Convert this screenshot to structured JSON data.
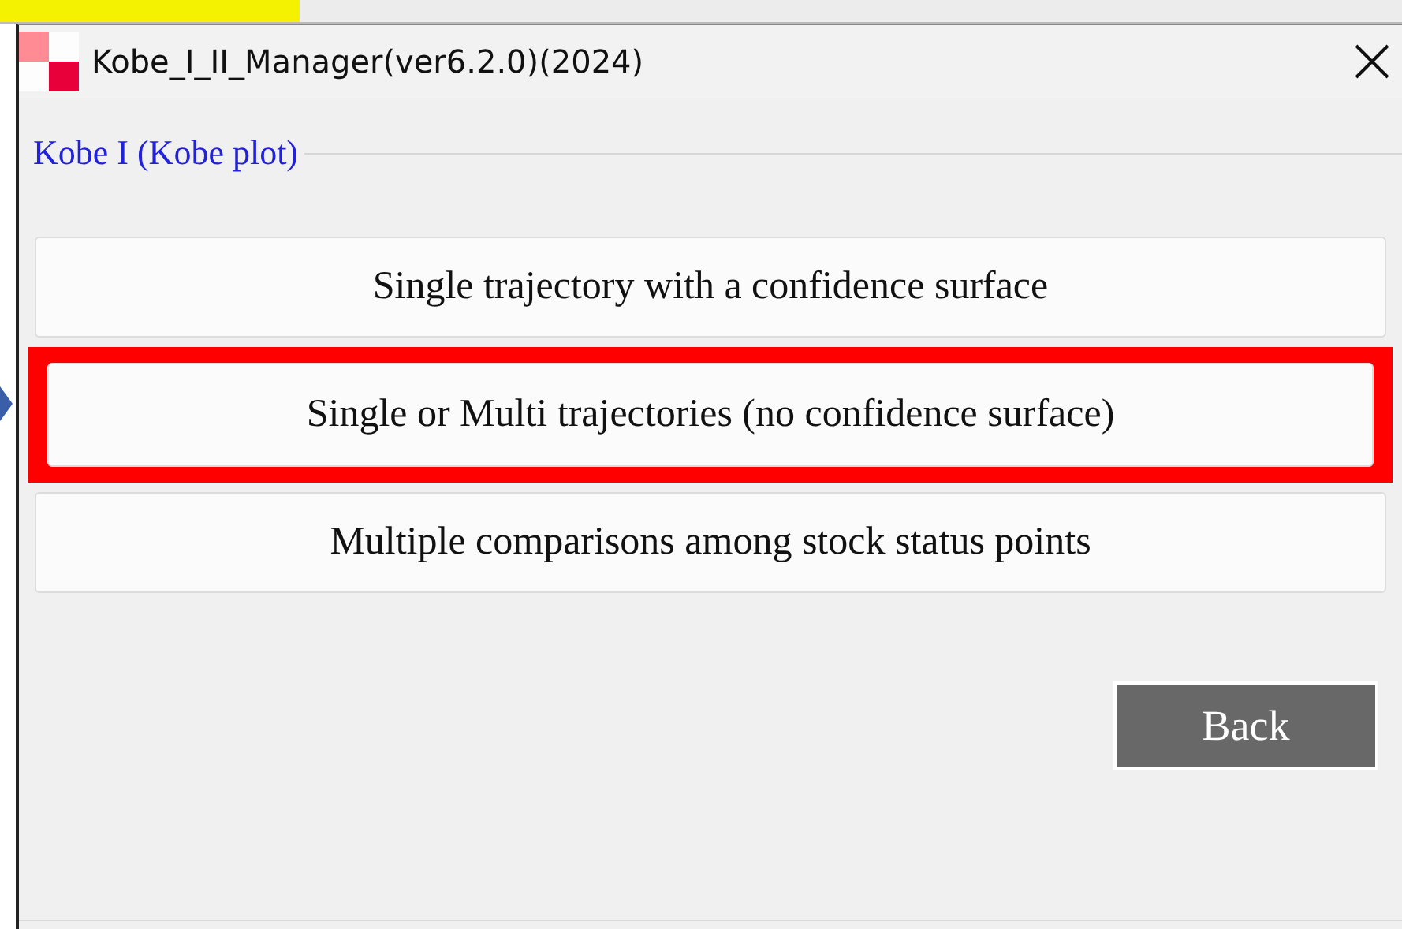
{
  "window": {
    "title": "Kobe_I_II_Manager(ver6.2.0)(2024)"
  },
  "section": {
    "label": "Kobe I (Kobe plot)"
  },
  "options": [
    {
      "label": "Single trajectory with a confidence surface",
      "highlighted": false
    },
    {
      "label": "Single or Multi trajectories (no confidence surface)",
      "highlighted": true
    },
    {
      "label": "Multiple comparisons among stock status points",
      "highlighted": false
    }
  ],
  "footer": {
    "back": "Back"
  }
}
